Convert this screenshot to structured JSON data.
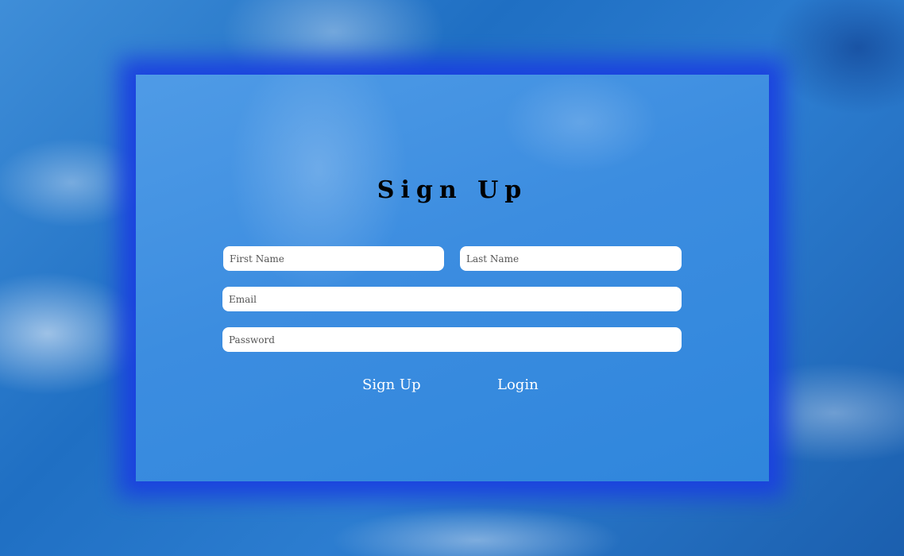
{
  "form": {
    "title": "Sign Up",
    "fields": {
      "first_name": {
        "value": "",
        "placeholder": "First Name"
      },
      "last_name": {
        "value": "",
        "placeholder": "Last Name"
      },
      "email": {
        "value": "",
        "placeholder": "Email"
      },
      "password": {
        "value": "",
        "placeholder": "Password"
      }
    },
    "buttons": {
      "signup_label": "Sign Up",
      "login_label": "Login"
    }
  },
  "colors": {
    "card_background": "#3c8de0",
    "card_glow": "#1a3fe0",
    "title_text": "#000000",
    "button_text": "#ffffff",
    "field_background": "#ffffff"
  }
}
